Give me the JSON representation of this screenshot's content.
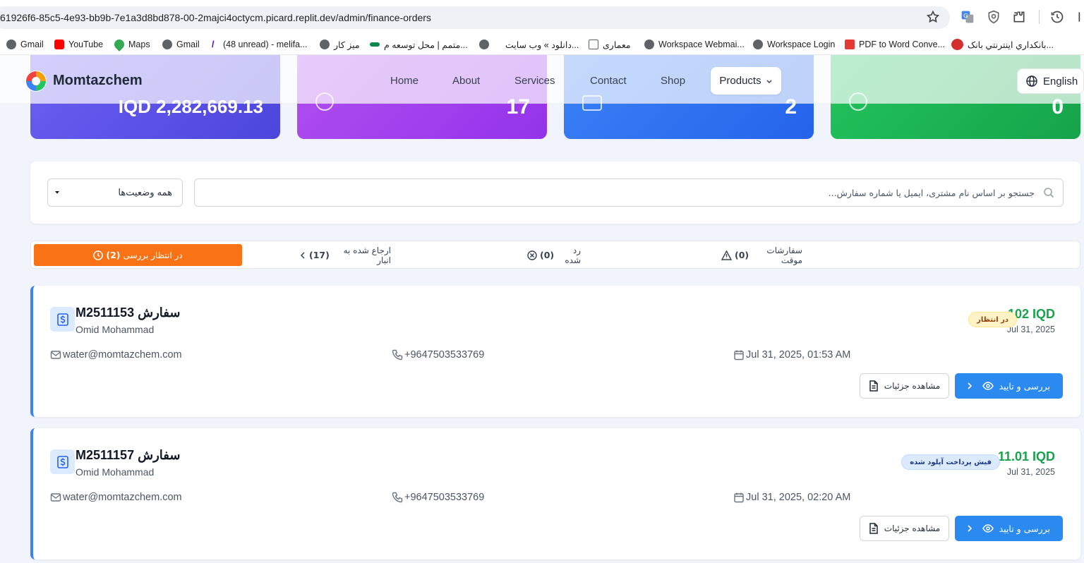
{
  "browser": {
    "url": "61926f6-85c5-4e93-bb9b-7e1a3d8bd878-00-2majci4octycm.picard.replit.dev/admin/finance-orders",
    "bookmarks": [
      {
        "label": "Gmail",
        "icon": "globe-icon",
        "color": "#5f6368"
      },
      {
        "label": "YouTube",
        "icon": "youtube-icon",
        "color": "#ff0000"
      },
      {
        "label": "Maps",
        "icon": "maps-icon",
        "color": "#34a853"
      },
      {
        "label": "Gmail",
        "icon": "globe-icon",
        "color": "#5f6368"
      },
      {
        "label": "(48 unread) - melifa...",
        "icon": "yahoo-icon",
        "color": "#6001d2"
      },
      {
        "label": "میز کار",
        "icon": "globe-icon",
        "color": "#5f6368"
      },
      {
        "label": "متمم | محل توسعه م...",
        "icon": "motamem-icon",
        "color": "#0a8a4a"
      },
      {
        "label": "",
        "icon": "globe-icon",
        "color": "#5f6368"
      },
      {
        "label": "دانلود » وب سایت...",
        "icon": "",
        "color": ""
      },
      {
        "label": "معماری",
        "icon": "folder-icon",
        "color": "#5f6368"
      },
      {
        "label": "Workspace Webmai...",
        "icon": "globe-icon",
        "color": "#5f6368"
      },
      {
        "label": "Workspace Login",
        "icon": "globe-icon",
        "color": "#5f6368"
      },
      {
        "label": "PDF to Word Conve...",
        "icon": "pdf-icon",
        "color": "#e53935"
      },
      {
        "label": "بانکداري اينترنتي بانک...",
        "icon": "bank-icon",
        "color": "#d32f2f"
      }
    ]
  },
  "nav": {
    "brand": "Momtazchem",
    "items": [
      "Home",
      "About",
      "Services",
      "Contact",
      "Shop"
    ],
    "products": "Products",
    "language": "English"
  },
  "stats": [
    {
      "value": "IQD 2,282,669.13",
      "color_from": "#6d5ef2",
      "color_to": "#4c46dc"
    },
    {
      "value": "17",
      "color_from": "#b24ff0",
      "color_to": "#9333ea"
    },
    {
      "value": "2",
      "color_from": "#3b82f6",
      "color_to": "#2563eb"
    },
    {
      "value": "0",
      "color_from": "#22c55e",
      "color_to": "#16a34a"
    }
  ],
  "filters": {
    "status_select": "همه وضعیت‌ها",
    "search_placeholder": "جستجو بر اساس نام مشتری، ایمیل یا شماره سفارش..."
  },
  "tabs": [
    {
      "label": "در انتظار بررسی",
      "count": "(2)",
      "icon": "clock-icon",
      "active": true
    },
    {
      "label": "ارجاع شده به انبار",
      "count": "(17)",
      "icon": "chevron-left-icon",
      "active": false
    },
    {
      "label": "رد شده",
      "count": "(0)",
      "icon": "x-circle-icon",
      "active": false
    },
    {
      "label": "سفارشات موقت",
      "count": "(0)",
      "icon": "warning-icon",
      "active": false
    }
  ],
  "orders": [
    {
      "title": "سفارش M2511153",
      "customer": "Omid Mohammad",
      "amount": "102 IQD",
      "date": "Jul 31, 2025",
      "badge": "در انتظار",
      "badge_bg": "#fef3c7",
      "badge_color": "#92400e",
      "email": "water@momtazchem.com",
      "phone": "+9647503533769",
      "datetime": "Jul 31, 2025, 01:53 AM",
      "detail_btn": "مشاهده جزئیات",
      "review_btn": "بررسی و تایید"
    },
    {
      "title": "سفارش M2511157",
      "customer": "Omid Mohammad",
      "amount": "11.01 IQD",
      "date": "Jul 31, 2025",
      "badge": "فیش پرداخت آپلود شده",
      "badge_bg": "#dbeafe",
      "badge_color": "#1e3a8a",
      "email": "water@momtazchem.com",
      "phone": "+9647503533769",
      "datetime": "Jul 31, 2025, 02:20 AM",
      "detail_btn": "مشاهده جزئیات",
      "review_btn": "بررسی و تایید"
    }
  ]
}
